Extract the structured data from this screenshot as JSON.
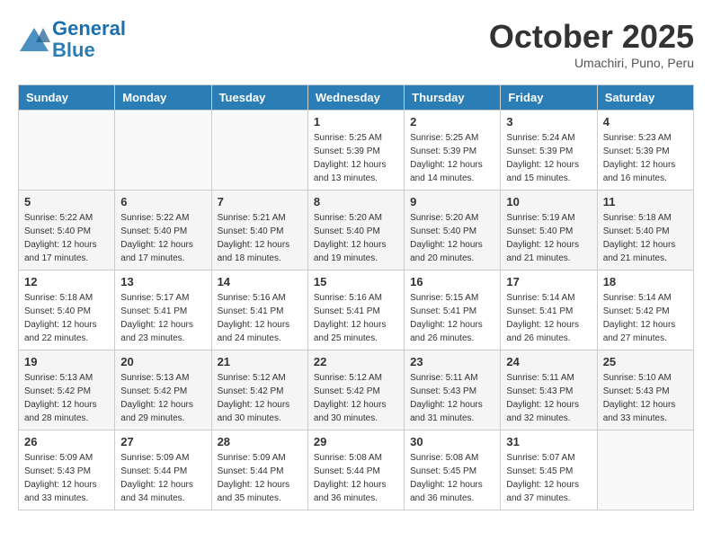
{
  "header": {
    "logo_line1": "General",
    "logo_line2": "Blue",
    "month": "October 2025",
    "location": "Umachiri, Puno, Peru"
  },
  "days_of_week": [
    "Sunday",
    "Monday",
    "Tuesday",
    "Wednesday",
    "Thursday",
    "Friday",
    "Saturday"
  ],
  "weeks": [
    [
      {
        "day": "",
        "info": ""
      },
      {
        "day": "",
        "info": ""
      },
      {
        "day": "",
        "info": ""
      },
      {
        "day": "1",
        "info": "Sunrise: 5:25 AM\nSunset: 5:39 PM\nDaylight: 12 hours\nand 13 minutes."
      },
      {
        "day": "2",
        "info": "Sunrise: 5:25 AM\nSunset: 5:39 PM\nDaylight: 12 hours\nand 14 minutes."
      },
      {
        "day": "3",
        "info": "Sunrise: 5:24 AM\nSunset: 5:39 PM\nDaylight: 12 hours\nand 15 minutes."
      },
      {
        "day": "4",
        "info": "Sunrise: 5:23 AM\nSunset: 5:39 PM\nDaylight: 12 hours\nand 16 minutes."
      }
    ],
    [
      {
        "day": "5",
        "info": "Sunrise: 5:22 AM\nSunset: 5:40 PM\nDaylight: 12 hours\nand 17 minutes."
      },
      {
        "day": "6",
        "info": "Sunrise: 5:22 AM\nSunset: 5:40 PM\nDaylight: 12 hours\nand 17 minutes."
      },
      {
        "day": "7",
        "info": "Sunrise: 5:21 AM\nSunset: 5:40 PM\nDaylight: 12 hours\nand 18 minutes."
      },
      {
        "day": "8",
        "info": "Sunrise: 5:20 AM\nSunset: 5:40 PM\nDaylight: 12 hours\nand 19 minutes."
      },
      {
        "day": "9",
        "info": "Sunrise: 5:20 AM\nSunset: 5:40 PM\nDaylight: 12 hours\nand 20 minutes."
      },
      {
        "day": "10",
        "info": "Sunrise: 5:19 AM\nSunset: 5:40 PM\nDaylight: 12 hours\nand 21 minutes."
      },
      {
        "day": "11",
        "info": "Sunrise: 5:18 AM\nSunset: 5:40 PM\nDaylight: 12 hours\nand 21 minutes."
      }
    ],
    [
      {
        "day": "12",
        "info": "Sunrise: 5:18 AM\nSunset: 5:40 PM\nDaylight: 12 hours\nand 22 minutes."
      },
      {
        "day": "13",
        "info": "Sunrise: 5:17 AM\nSunset: 5:41 PM\nDaylight: 12 hours\nand 23 minutes."
      },
      {
        "day": "14",
        "info": "Sunrise: 5:16 AM\nSunset: 5:41 PM\nDaylight: 12 hours\nand 24 minutes."
      },
      {
        "day": "15",
        "info": "Sunrise: 5:16 AM\nSunset: 5:41 PM\nDaylight: 12 hours\nand 25 minutes."
      },
      {
        "day": "16",
        "info": "Sunrise: 5:15 AM\nSunset: 5:41 PM\nDaylight: 12 hours\nand 26 minutes."
      },
      {
        "day": "17",
        "info": "Sunrise: 5:14 AM\nSunset: 5:41 PM\nDaylight: 12 hours\nand 26 minutes."
      },
      {
        "day": "18",
        "info": "Sunrise: 5:14 AM\nSunset: 5:42 PM\nDaylight: 12 hours\nand 27 minutes."
      }
    ],
    [
      {
        "day": "19",
        "info": "Sunrise: 5:13 AM\nSunset: 5:42 PM\nDaylight: 12 hours\nand 28 minutes."
      },
      {
        "day": "20",
        "info": "Sunrise: 5:13 AM\nSunset: 5:42 PM\nDaylight: 12 hours\nand 29 minutes."
      },
      {
        "day": "21",
        "info": "Sunrise: 5:12 AM\nSunset: 5:42 PM\nDaylight: 12 hours\nand 30 minutes."
      },
      {
        "day": "22",
        "info": "Sunrise: 5:12 AM\nSunset: 5:42 PM\nDaylight: 12 hours\nand 30 minutes."
      },
      {
        "day": "23",
        "info": "Sunrise: 5:11 AM\nSunset: 5:43 PM\nDaylight: 12 hours\nand 31 minutes."
      },
      {
        "day": "24",
        "info": "Sunrise: 5:11 AM\nSunset: 5:43 PM\nDaylight: 12 hours\nand 32 minutes."
      },
      {
        "day": "25",
        "info": "Sunrise: 5:10 AM\nSunset: 5:43 PM\nDaylight: 12 hours\nand 33 minutes."
      }
    ],
    [
      {
        "day": "26",
        "info": "Sunrise: 5:09 AM\nSunset: 5:43 PM\nDaylight: 12 hours\nand 33 minutes."
      },
      {
        "day": "27",
        "info": "Sunrise: 5:09 AM\nSunset: 5:44 PM\nDaylight: 12 hours\nand 34 minutes."
      },
      {
        "day": "28",
        "info": "Sunrise: 5:09 AM\nSunset: 5:44 PM\nDaylight: 12 hours\nand 35 minutes."
      },
      {
        "day": "29",
        "info": "Sunrise: 5:08 AM\nSunset: 5:44 PM\nDaylight: 12 hours\nand 36 minutes."
      },
      {
        "day": "30",
        "info": "Sunrise: 5:08 AM\nSunset: 5:45 PM\nDaylight: 12 hours\nand 36 minutes."
      },
      {
        "day": "31",
        "info": "Sunrise: 5:07 AM\nSunset: 5:45 PM\nDaylight: 12 hours\nand 37 minutes."
      },
      {
        "day": "",
        "info": ""
      }
    ]
  ]
}
